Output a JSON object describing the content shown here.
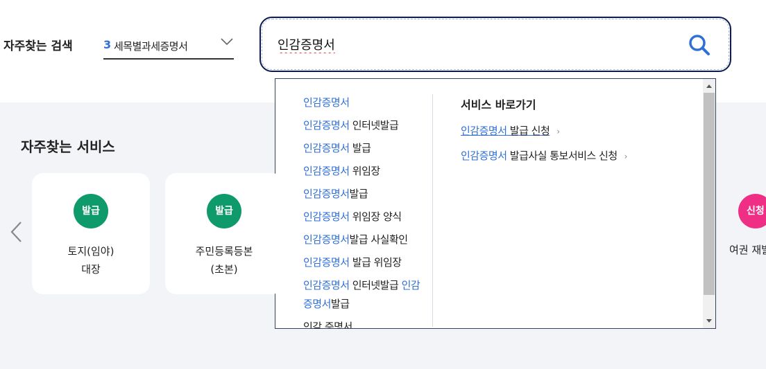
{
  "frequent_search": {
    "label": "자주찾는 검색",
    "rank": "3",
    "selected": "세목별과세증명서"
  },
  "search": {
    "value": "인감증명서"
  },
  "suggestions": [
    {
      "kw": "인감증명서",
      "rest": ""
    },
    {
      "kw": "인감증명서",
      "rest": " 인터넷발급"
    },
    {
      "kw": "인감증명서",
      "rest": " 발급"
    },
    {
      "kw": "인감증명서",
      "rest": " 위임장"
    },
    {
      "kw": "인감증명서",
      "rest": "발급"
    },
    {
      "kw": "인감증명서",
      "rest": " 위임장 양식"
    },
    {
      "kw": "인감증명서",
      "rest": "발급 사실확인"
    },
    {
      "kw": "인감증명서",
      "rest": " 발급 위임장"
    },
    {
      "kw": "인감증명서",
      "rest": " 인터넷발급 ",
      "kw2": "인감증명서",
      "rest2": "발급"
    },
    {
      "kw": "",
      "rest": "인감 증명서"
    }
  ],
  "service_shortcuts": {
    "title": "서비스 바로가기",
    "links": [
      {
        "kw": "인감증명서",
        "rest": " 발급 신청"
      },
      {
        "kw": "인감증명서",
        "rest": " 발급사실 통보서비스 신청"
      }
    ]
  },
  "services": {
    "heading": "자주찾는 서비스",
    "cards": [
      {
        "badge": "발급",
        "line1": "토지(임야)",
        "line2": "대장"
      },
      {
        "badge": "발급",
        "line1": "주민등록등본",
        "line2": "(초본)"
      }
    ],
    "right_card": {
      "badge": "신청",
      "label": "여권 재발"
    }
  },
  "colors": {
    "accent_blue": "#2f6fd6",
    "badge_green": "#0f9a6b",
    "badge_pink": "#ef2f86"
  },
  "icons": {
    "search": "magnifier-icon",
    "dropdown": "chevron-down-icon",
    "prev": "chevron-left-icon",
    "link_arrow": "chevron-right-icon"
  }
}
